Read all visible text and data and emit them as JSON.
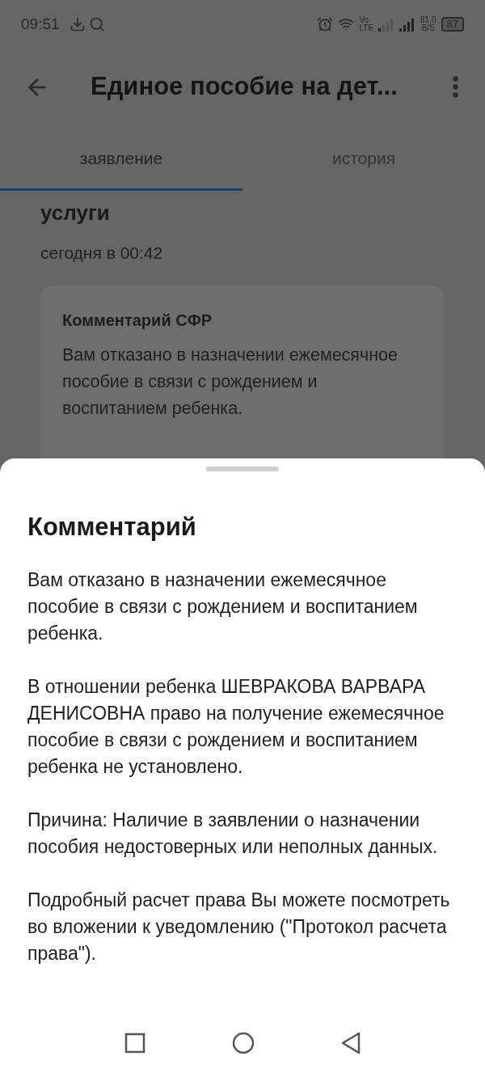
{
  "status_bar": {
    "time": "09:51",
    "network": [
      "Vo",
      "LTE"
    ],
    "speed": [
      "81,0",
      "B/S"
    ],
    "battery": "87"
  },
  "toolbar": {
    "title": "Единое пособие на дет..."
  },
  "tabs": [
    {
      "label": "заявление",
      "selected": true
    },
    {
      "label": "история",
      "selected": false
    }
  ],
  "card": {
    "title": "услуги",
    "time": "сегодня в 00:42",
    "comment": {
      "title": "Комментарий СФР",
      "text": "Вам отказано в назначении ежемесячное пособие в связи с рождением и воспитанием ребенка."
    }
  },
  "sheet": {
    "title": "Комментарий",
    "paragraphs": [
      "Вам отказано в назначении ежемесячное пособие в связи с рождением и воспитанием ребенка.",
      "В отношении ребенка ШЕВРАКОВА ВАРВАРА ДЕНИСОВНА право на получение ежемесячное пособие в связи с рождением и воспитанием ребенка не установлено.",
      "Причина: Наличие в заявлении о назначении пособия недостоверных или неполных данных.",
      "Подробный расчет права Вы можете посмотреть во вложении к уведомлению (\"Протокол расчета права\")."
    ]
  }
}
